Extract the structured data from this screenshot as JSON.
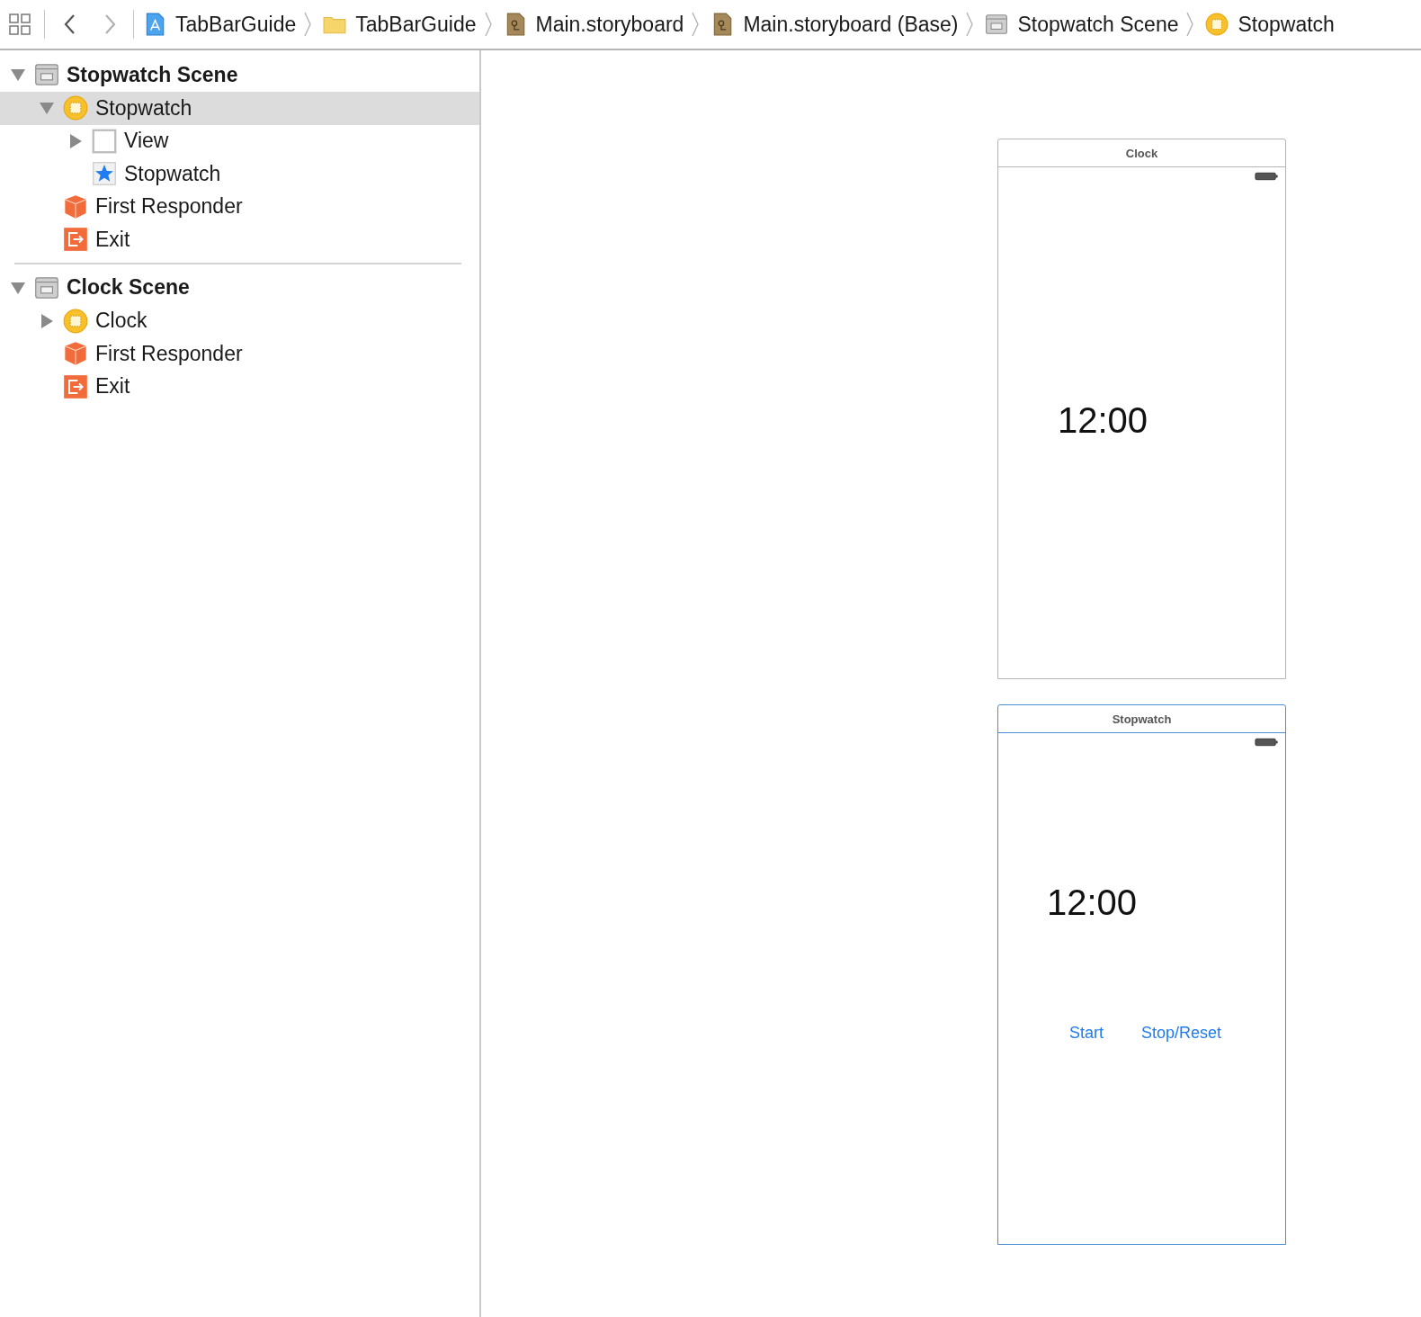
{
  "toolbar": {
    "back": {
      "disabled": false
    },
    "forward": {
      "disabled": true
    }
  },
  "breadcrumbs": [
    {
      "label": "TabBarGuide",
      "kind": "project"
    },
    {
      "label": "TabBarGuide",
      "kind": "folder"
    },
    {
      "label": "Main.storyboard",
      "kind": "storyboard"
    },
    {
      "label": "Main.storyboard (Base)",
      "kind": "storyboard"
    },
    {
      "label": "Stopwatch Scene",
      "kind": "scene"
    },
    {
      "label": "Stopwatch",
      "kind": "controller"
    }
  ],
  "outline": [
    {
      "label": "Stopwatch Scene",
      "kind": "scene",
      "expanded": true,
      "selected": false,
      "children": [
        {
          "label": "Stopwatch",
          "kind": "controller",
          "expanded": true,
          "selected": true,
          "children": [
            {
              "label": "View",
              "kind": "view",
              "expanded": false,
              "selected": false
            },
            {
              "label": "Stopwatch",
              "kind": "tabitem",
              "selected": false
            }
          ]
        },
        {
          "label": "First Responder",
          "kind": "responder",
          "selected": false
        },
        {
          "label": "Exit",
          "kind": "exit",
          "selected": false
        }
      ]
    },
    {
      "label": "Clock Scene",
      "kind": "scene",
      "expanded": true,
      "selected": false,
      "children": [
        {
          "label": "Clock",
          "kind": "controller",
          "expanded": false,
          "selected": false
        },
        {
          "label": "First Responder",
          "kind": "responder",
          "selected": false
        },
        {
          "label": "Exit",
          "kind": "exit",
          "selected": false
        }
      ]
    }
  ],
  "canvas": {
    "scenes": [
      {
        "title": "Clock",
        "selected": false,
        "time": "12:00"
      },
      {
        "title": "Stopwatch",
        "selected": true,
        "time": "12:00",
        "buttons": [
          "Start",
          "Stop/Reset"
        ]
      }
    ]
  }
}
